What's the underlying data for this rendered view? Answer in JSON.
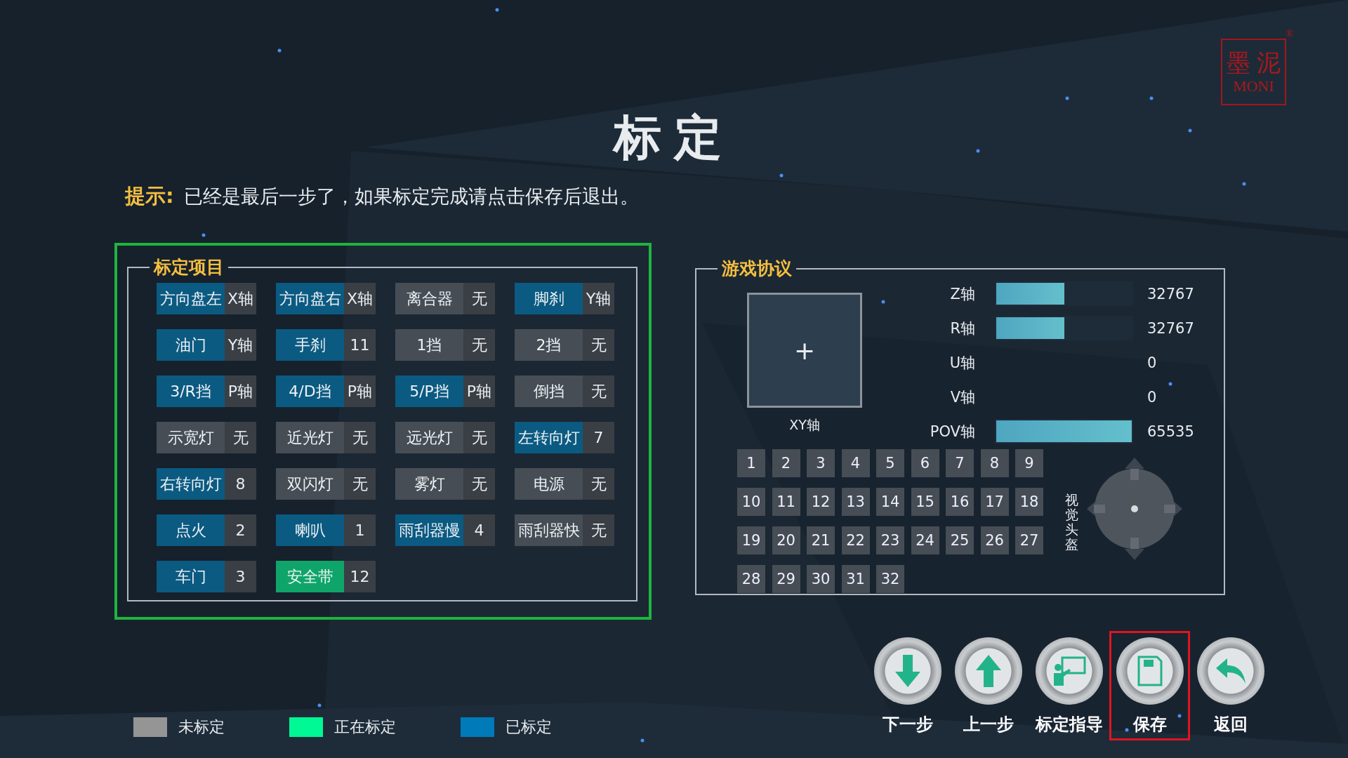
{
  "logo": {
    "name": "墨 泥",
    "latin": "MONI",
    "mark": "®"
  },
  "title": "标定",
  "hint": {
    "label": "提示:",
    "text": "已经是最后一步了，如果标定完成请点击保存后退出。"
  },
  "calibration": {
    "title": "标定项目",
    "highlighted": true,
    "items": [
      {
        "label": "方向盘左",
        "value": "X轴",
        "color": "#0b5a82"
      },
      {
        "label": "方向盘右",
        "value": "X轴",
        "color": "#0b5a82"
      },
      {
        "label": "离合器",
        "value": "无",
        "color": "#464d55"
      },
      {
        "label": "脚刹",
        "value": "Y轴",
        "color": "#0b5a82"
      },
      {
        "label": "油门",
        "value": "Y轴",
        "color": "#0b5a82"
      },
      {
        "label": "手刹",
        "value": "11",
        "color": "#0b5a82"
      },
      {
        "label": "1挡",
        "value": "无",
        "color": "#464d55"
      },
      {
        "label": "2挡",
        "value": "无",
        "color": "#464d55"
      },
      {
        "label": "3/R挡",
        "value": "P轴",
        "color": "#0b5a82"
      },
      {
        "label": "4/D挡",
        "value": "P轴",
        "color": "#0b5a82"
      },
      {
        "label": "5/P挡",
        "value": "P轴",
        "color": "#0b5a82"
      },
      {
        "label": "倒挡",
        "value": "无",
        "color": "#464d55"
      },
      {
        "label": "示宽灯",
        "value": "无",
        "color": "#464d55"
      },
      {
        "label": "近光灯",
        "value": "无",
        "color": "#464d55"
      },
      {
        "label": "远光灯",
        "value": "无",
        "color": "#464d55"
      },
      {
        "label": "左转向灯",
        "value": "7",
        "color": "#0b5a82"
      },
      {
        "label": "右转向灯",
        "value": "8",
        "color": "#0b5a82"
      },
      {
        "label": "双闪灯",
        "value": "无",
        "color": "#464d55"
      },
      {
        "label": "雾灯",
        "value": "无",
        "color": "#464d55"
      },
      {
        "label": "电源",
        "value": "无",
        "color": "#464d55"
      },
      {
        "label": "点火",
        "value": "2",
        "color": "#0b5a82"
      },
      {
        "label": "喇叭",
        "value": "1",
        "color": "#0b5a82"
      },
      {
        "label": "雨刮器慢",
        "value": "4",
        "color": "#0b5a82"
      },
      {
        "label": "雨刮器快",
        "value": "无",
        "color": "#464d55"
      },
      {
        "label": "车门",
        "value": "3",
        "color": "#0b5a82"
      },
      {
        "label": "安全带",
        "value": "12",
        "color": "#0fa56a"
      }
    ]
  },
  "protocol": {
    "title": "游戏协议",
    "xy_label": "XY轴",
    "xy_mark": "+",
    "axes": [
      {
        "label": "Z轴",
        "level": 0.5,
        "value": "32767"
      },
      {
        "label": "R轴",
        "level": 0.5,
        "value": "32767"
      },
      {
        "label": "U轴",
        "value": "0"
      },
      {
        "label": "V轴",
        "value": "0"
      },
      {
        "label": "POV轴",
        "level": 1,
        "value": "65535"
      }
    ],
    "buttons": [
      "1",
      "2",
      "3",
      "4",
      "5",
      "6",
      "7",
      "8",
      "9",
      "10",
      "11",
      "12",
      "13",
      "14",
      "15",
      "16",
      "17",
      "18",
      "19",
      "20",
      "21",
      "22",
      "23",
      "24",
      "25",
      "26",
      "27",
      "28",
      "29",
      "30",
      "31",
      "32"
    ],
    "hat_label": "视觉头盔"
  },
  "legend": [
    {
      "label": "未标定",
      "color": "#959595"
    },
    {
      "label": "正在标定",
      "color": "#00f994"
    },
    {
      "label": "已标定",
      "color": "#007ab9"
    }
  ],
  "actions": [
    {
      "label": "下一步",
      "highlighted": false
    },
    {
      "label": "上一步",
      "highlighted": false
    },
    {
      "label": "标定指导",
      "highlighted": false
    },
    {
      "label": "保存",
      "highlighted": true
    },
    {
      "label": "返回",
      "highlighted": false
    }
  ]
}
